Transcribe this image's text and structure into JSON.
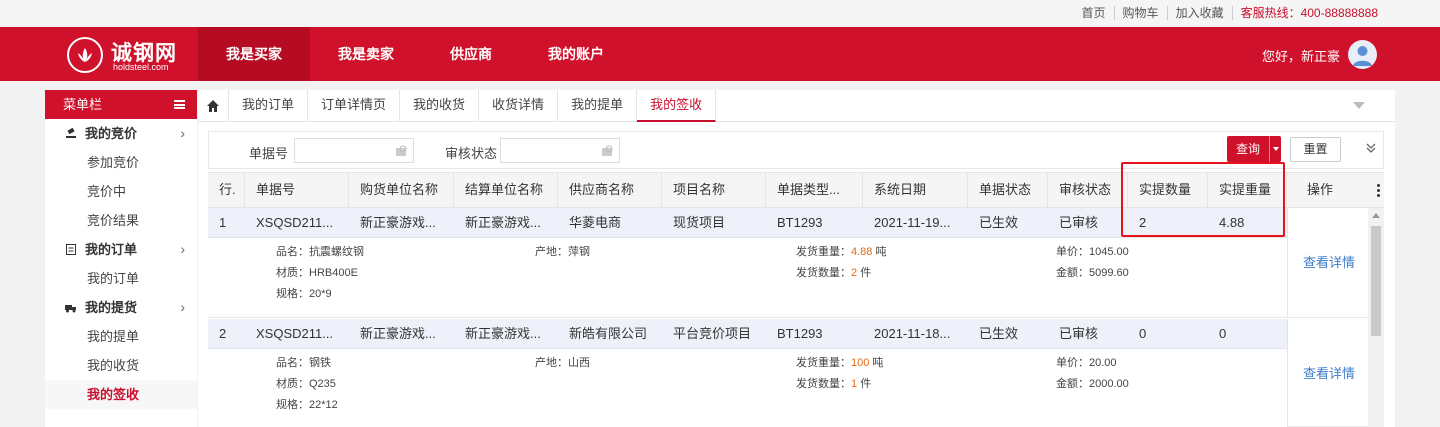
{
  "topbar": {
    "links": [
      "首页",
      "购物车",
      "加入收藏"
    ],
    "hotline": "客服热线：400-88888888"
  },
  "header": {
    "logo_text": "诚钢网",
    "logo_sub": "holdsteel.com",
    "nav": [
      "我是买家",
      "我是卖家",
      "供应商",
      "我的账户"
    ],
    "greeting": "您好，新正豪"
  },
  "sidebar": {
    "title": "菜单栏",
    "groups": [
      {
        "label": "我的竞价",
        "items": [
          "参加竞价",
          "竞价中",
          "竞价结果"
        ]
      },
      {
        "label": "我的订单",
        "items": [
          "我的订单"
        ]
      },
      {
        "label": "我的提货",
        "items": [
          "我的提单",
          "我的收货",
          "我的签收"
        ]
      }
    ]
  },
  "tabs": [
    "我的订单",
    "订单详情页",
    "我的收货",
    "收货详情",
    "我的提单",
    "我的签收"
  ],
  "filter": {
    "doc_no_label": "单据号",
    "audit_label": "审核状态",
    "query_label": "查询",
    "reset_label": "重置"
  },
  "table": {
    "columns": [
      "行.",
      "单据号",
      "购货单位名称",
      "结算单位名称",
      "供应商名称",
      "项目名称",
      "单据类型...",
      "系统日期",
      "单据状态",
      "审核状态",
      "实提数量",
      "实提重量",
      "操作"
    ],
    "rows": [
      {
        "cells": [
          "1",
          "XSQSD211...",
          "新正豪游戏...",
          "新正豪游戏...",
          "华菱电商",
          "现货项目",
          "BT1293",
          "2021-11-19...",
          "已生效",
          "已审核",
          "2",
          "4.88"
        ],
        "detail": {
          "name": "品名：抗震螺纹钢",
          "material": "材质：HRB400E",
          "spec": "规格：20*9",
          "origin": "产地：萍钢",
          "weight_label": "发货重量：",
          "weight": "4.88",
          "weight_unit": "吨",
          "qty_label": "发货数量：",
          "qty": "2",
          "qty_unit": "件",
          "price": "单价：1045.00",
          "amount": "金额：5099.60"
        },
        "op": "查看详情"
      },
      {
        "cells": [
          "2",
          "XSQSD211...",
          "新正豪游戏...",
          "新正豪游戏...",
          "新皓有限公司",
          "平台竞价项目",
          "BT1293",
          "2021-11-18...",
          "已生效",
          "已审核",
          "0",
          "0"
        ],
        "detail": {
          "name": "品名：钢铁",
          "material": "材质：Q235",
          "spec": "规格：22*12",
          "origin": "产地：山西",
          "weight_label": "发货重量：",
          "weight": "100",
          "weight_unit": "吨",
          "qty_label": "发货数量：",
          "qty": "1",
          "qty_unit": "件",
          "price": "单价：20.00",
          "amount": "金额：2000.00"
        },
        "op": "查看详情"
      }
    ]
  },
  "colors": {
    "brand": "#d0112b",
    "link": "#3c7cc9",
    "highlight": "#e36a11",
    "annotation": "#e8131a"
  }
}
